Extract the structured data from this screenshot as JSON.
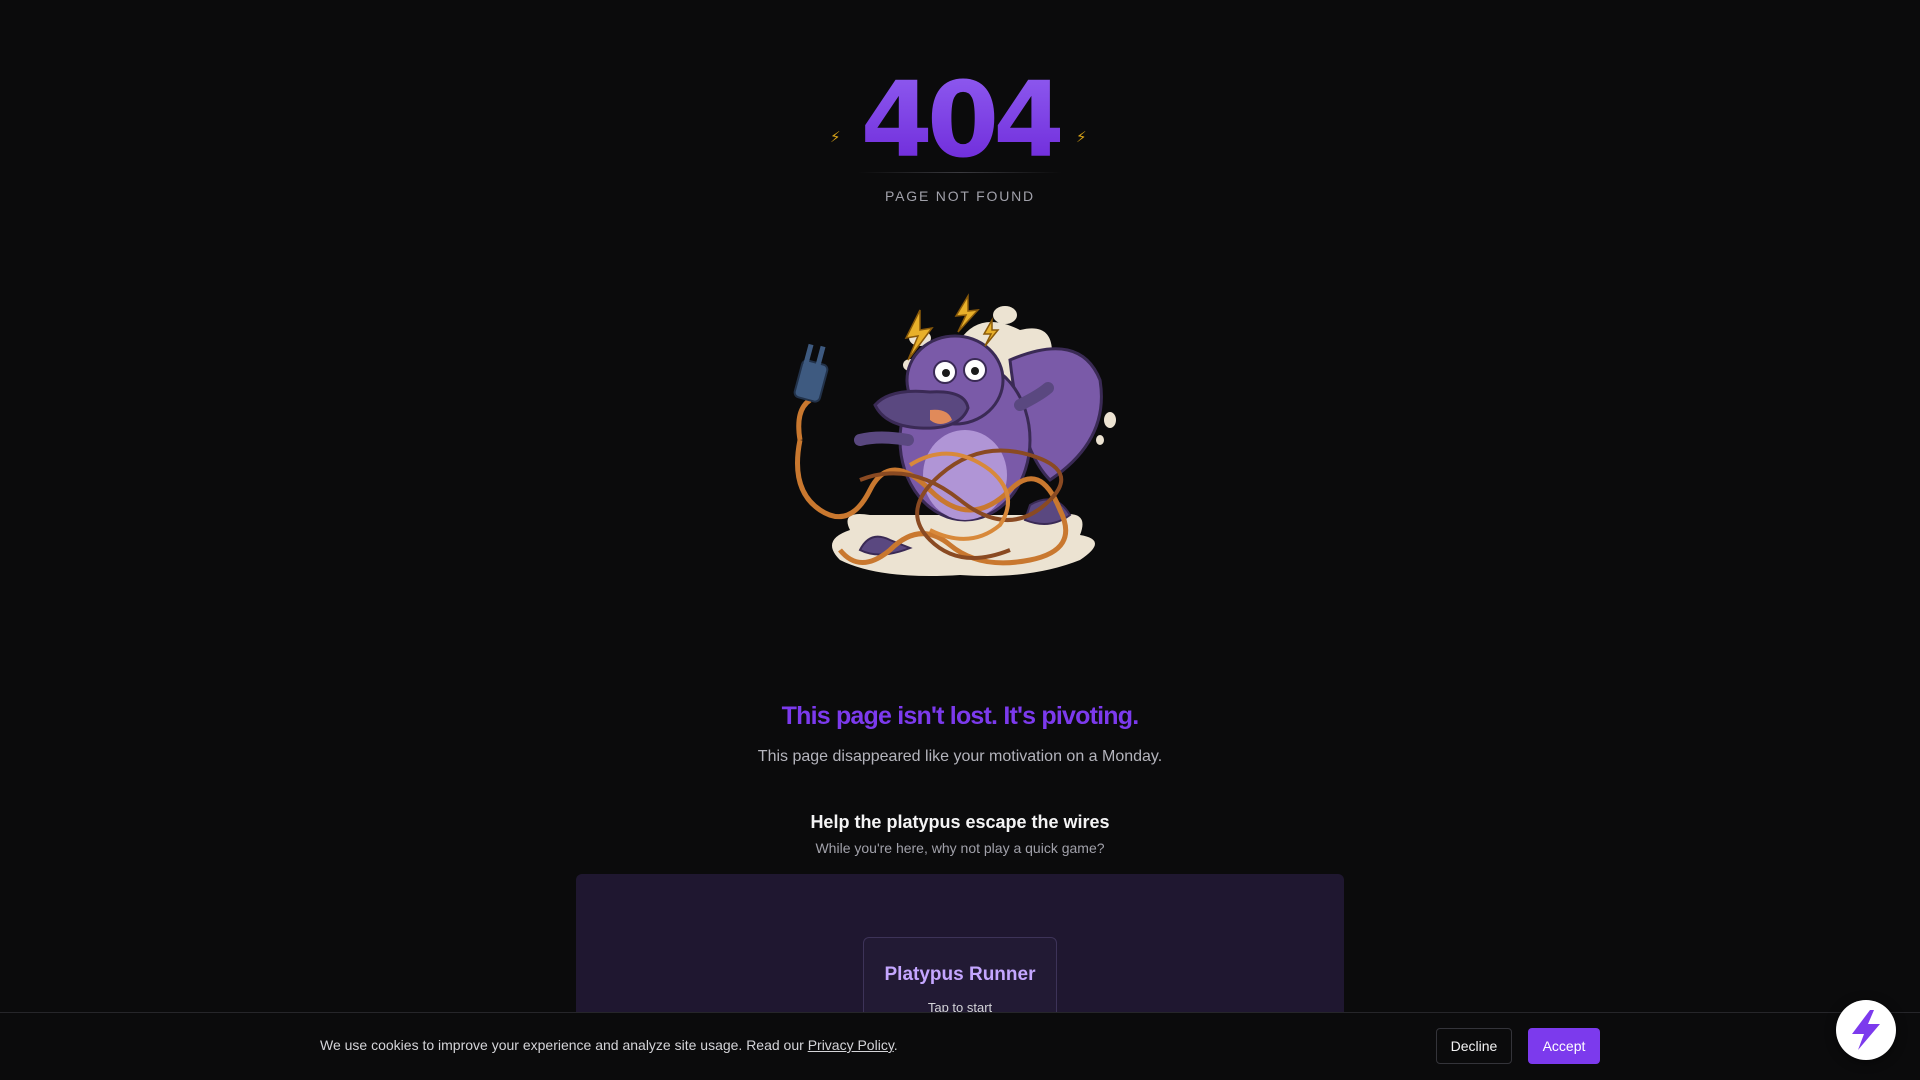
{
  "error": {
    "code": "404",
    "label": "PAGE NOT FOUND"
  },
  "illustration": {
    "subject": "tangled-platypus"
  },
  "content": {
    "headline": "This page isn't lost. It's pivoting.",
    "tagline": "This page disappeared like your motivation on a Monday."
  },
  "game": {
    "title": "Help the platypus escape the wires",
    "subtitle": "While you're here, why not play a quick game?",
    "card_title": "Platypus Runner",
    "card_hint": "Tap to start"
  },
  "cookie_banner": {
    "text": "We use cookies to improve your experience and analyze site usage. Read our ",
    "link_label": "Privacy Policy",
    "text_end": ".",
    "decline_label": "Decline",
    "accept_label": "Accept"
  },
  "fab": {
    "icon": "lightning-bolt-icon"
  },
  "colors": {
    "background": "#0b0b0c",
    "accent": "#7c3aed",
    "panel": "#1f1730",
    "card_title": "#c4a6ff",
    "spark": "#d4a017"
  }
}
